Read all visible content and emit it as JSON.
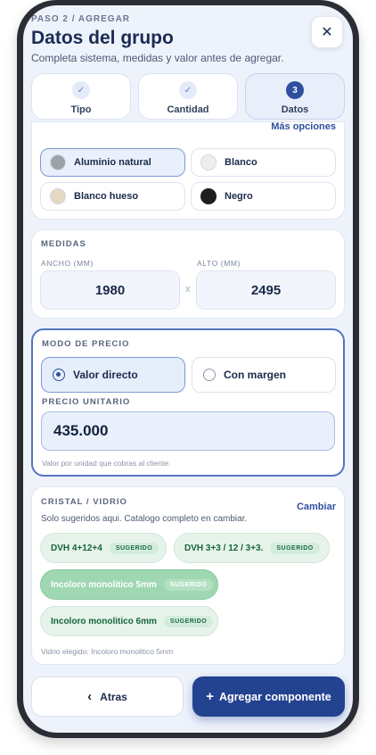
{
  "header": {
    "step": "PASO 2 / AGREGAR",
    "title": "Datos del grupo",
    "subtitle": "Completa sistema, medidas y valor antes de agregar.",
    "close_icon": "✕"
  },
  "stepper": [
    {
      "label": "Tipo",
      "state": "done",
      "marker": "✓"
    },
    {
      "label": "Cantidad",
      "state": "done",
      "marker": "✓"
    },
    {
      "label": "Datos",
      "state": "current",
      "marker": "3"
    }
  ],
  "colors": {
    "more_label": "Más opciones",
    "options": [
      {
        "label": "Aluminio natural",
        "swatch": "#9da2a8",
        "selected": true
      },
      {
        "label": "Blanco",
        "swatch": "#eeeeee",
        "selected": false
      },
      {
        "label": "Blanco hueso",
        "swatch": "#e6d8c2",
        "selected": false
      },
      {
        "label": "Negro",
        "swatch": "#1e1e1e",
        "selected": false
      }
    ]
  },
  "medidas": {
    "title": "MEDIDAS",
    "ancho_label": "ANCHO (MM)",
    "ancho_value": "1980",
    "alto_label": "ALTO (MM)",
    "alto_value": "2495",
    "separator": "x"
  },
  "precio": {
    "title": "MODO DE PRECIO",
    "options": [
      {
        "label": "Valor directo",
        "selected": true
      },
      {
        "label": "Con margen",
        "selected": false
      }
    ],
    "unit_label": "PRECIO UNITARIO",
    "unit_value": "435.000",
    "helper": "Valor por unidad que cobras al cliente."
  },
  "cristal": {
    "title": "CRISTAL / VIDRIO",
    "change_label": "Cambiar",
    "description": "Solo sugeridos aqui. Catalogo completo en cambiar.",
    "chips": [
      {
        "label": "DVH 4+12+4",
        "tag": "SUGERIDO",
        "selected": false
      },
      {
        "label": "DVH 3+3 / 12 / 3+3.",
        "tag": "SUGERIDO",
        "selected": false
      },
      {
        "label": "Incoloro monolitico 5mm",
        "tag": "SUGERIDO",
        "selected": true
      },
      {
        "label": "Incoloro monolitico 6mm",
        "tag": "SUGERIDO",
        "selected": false
      }
    ],
    "chosen": "Vidrio elegido: Incoloro monolitico 5mm"
  },
  "footer": {
    "back_label": "Atras",
    "back_icon": "‹",
    "add_label": "Agregar componente",
    "add_icon": "+"
  },
  "theme": {
    "accent": "#23428f",
    "suggested_green": "#17663a"
  }
}
